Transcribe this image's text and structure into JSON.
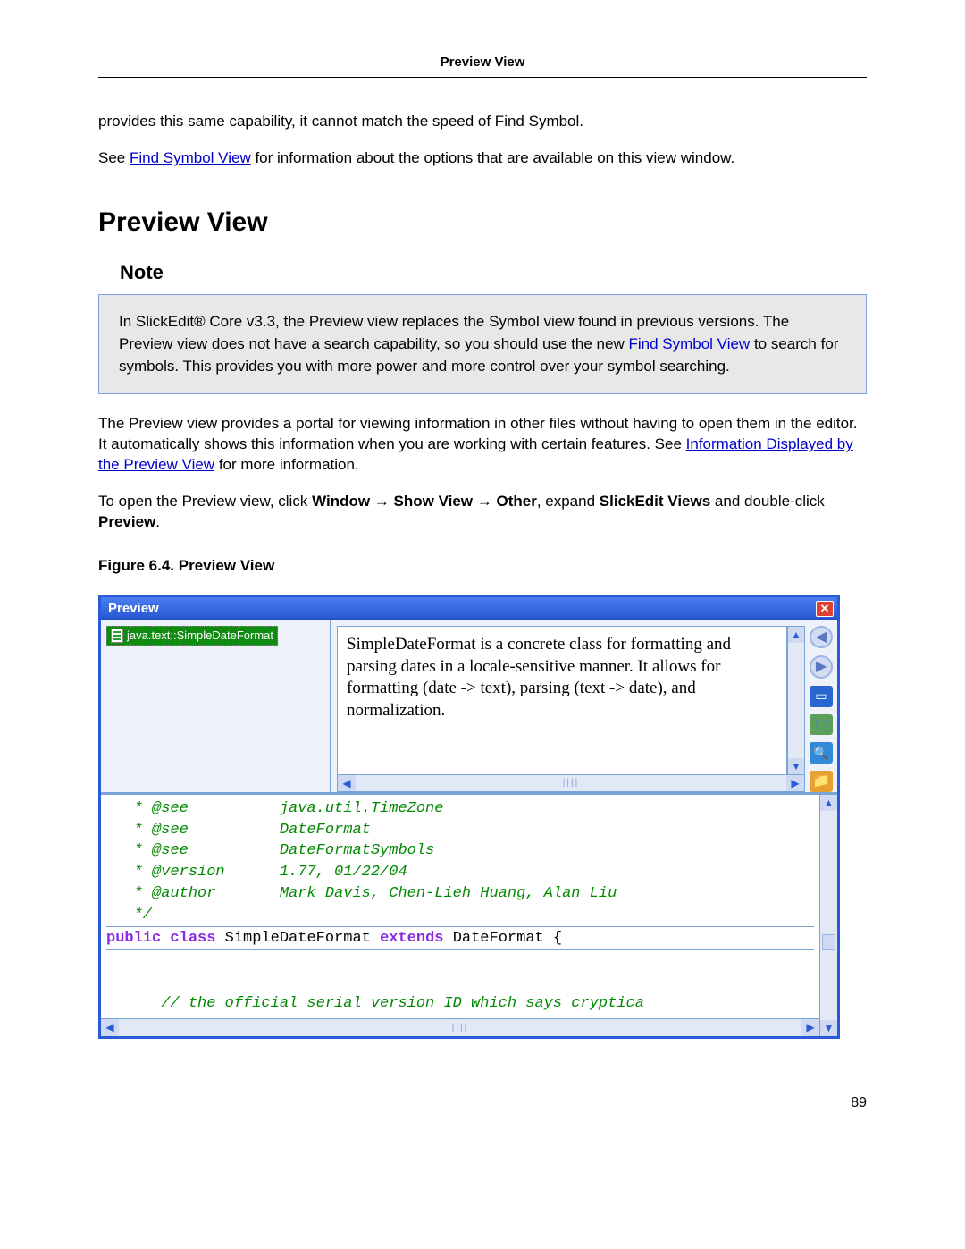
{
  "header": {
    "title": "Preview View"
  },
  "intro": {
    "p1": "provides this same capability, it cannot match the speed of Find Symbol.",
    "p2a": "See ",
    "p2_link": "Find Symbol View",
    "p2b": " for information about the options that are available on this view window."
  },
  "section_title": "Preview View",
  "note": {
    "title": "Note",
    "t1": "In SlickEdit® Core v3.3, the Preview view replaces the Symbol view found in previous versions. The Preview view does not have a search capability, so you should use the new ",
    "link": "Find Symbol View",
    "t2": " to search for symbols. This provides you with more power and more control over your symbol searching."
  },
  "body": {
    "p1a": "The Preview view provides a portal for viewing information in other files without having to open them in the editor. It automatically shows this information when you are working with certain features. See ",
    "p1_link": "Information Displayed by the Preview View",
    "p1b": " for more information.",
    "p2a": "To open the Preview view, click ",
    "p2_b1": "Window",
    "p2_arrow1": " → ",
    "p2_b2": "Show View",
    "p2_arrow2": " → ",
    "p2_b3": "Other",
    "p2_mid": ", expand ",
    "p2_b4": "SlickEdit Views",
    "p2_mid2": " and double-click ",
    "p2_b5": "Preview",
    "p2_end": "."
  },
  "figure_caption": "Figure 6.4. Preview View",
  "window": {
    "title": "Preview",
    "symbol": "java.text::SimpleDateFormat",
    "desc": "SimpleDateFormat is a concrete class for formatting and parsing dates in a locale-sensitive manner. It allows for formatting (date -> text), parsing (text -> date), and normalization.",
    "code": {
      "l1": "   * @see          java.util.TimeZone",
      "l2": "   * @see          DateFormat",
      "l3": "   * @see          DateFormatSymbols",
      "l4": "   * @version      1.77, 01/22/04",
      "l5": "   * @author       Mark Davis, Chen-Lieh Huang, Alan Liu",
      "l6": "   */",
      "decl_kw1": "public",
      "decl_kw2": "class",
      "decl_name": " SimpleDateFormat ",
      "decl_kw3": "extends",
      "decl_rest": " DateFormat {",
      "l8": "",
      "l9": "      // the official serial version ID which says cryptica"
    }
  },
  "page_number": "89"
}
